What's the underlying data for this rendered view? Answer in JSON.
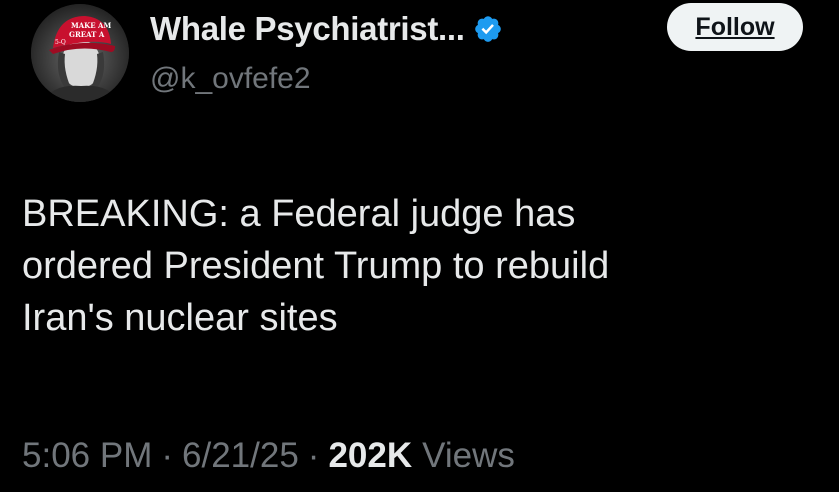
{
  "author": {
    "display_name": "Whale Psychiatrist...",
    "handle": "@k_ovfefe2",
    "verified": true,
    "avatar_hat_text_line1": "MAKE AM",
    "avatar_hat_text_line2": "GREAT A",
    "avatar_hat_side_text": "5-Q"
  },
  "actions": {
    "follow_label": "Follow"
  },
  "tweet": {
    "lines": [
      "BREAKING: a Federal judge has",
      "ordered President Trump to rebuild",
      "Iran's nuclear sites"
    ]
  },
  "meta": {
    "time": "5:06 PM",
    "separator": "·",
    "date": "6/21/25",
    "views_count": "202K",
    "views_label": "Views"
  },
  "colors": {
    "background": "#000000",
    "primary_text": "#e7e9ea",
    "secondary_text": "#71767b",
    "verified_blue": "#1d9bf0",
    "follow_bg": "#eff3f4",
    "hat_red": "#c8102e"
  }
}
